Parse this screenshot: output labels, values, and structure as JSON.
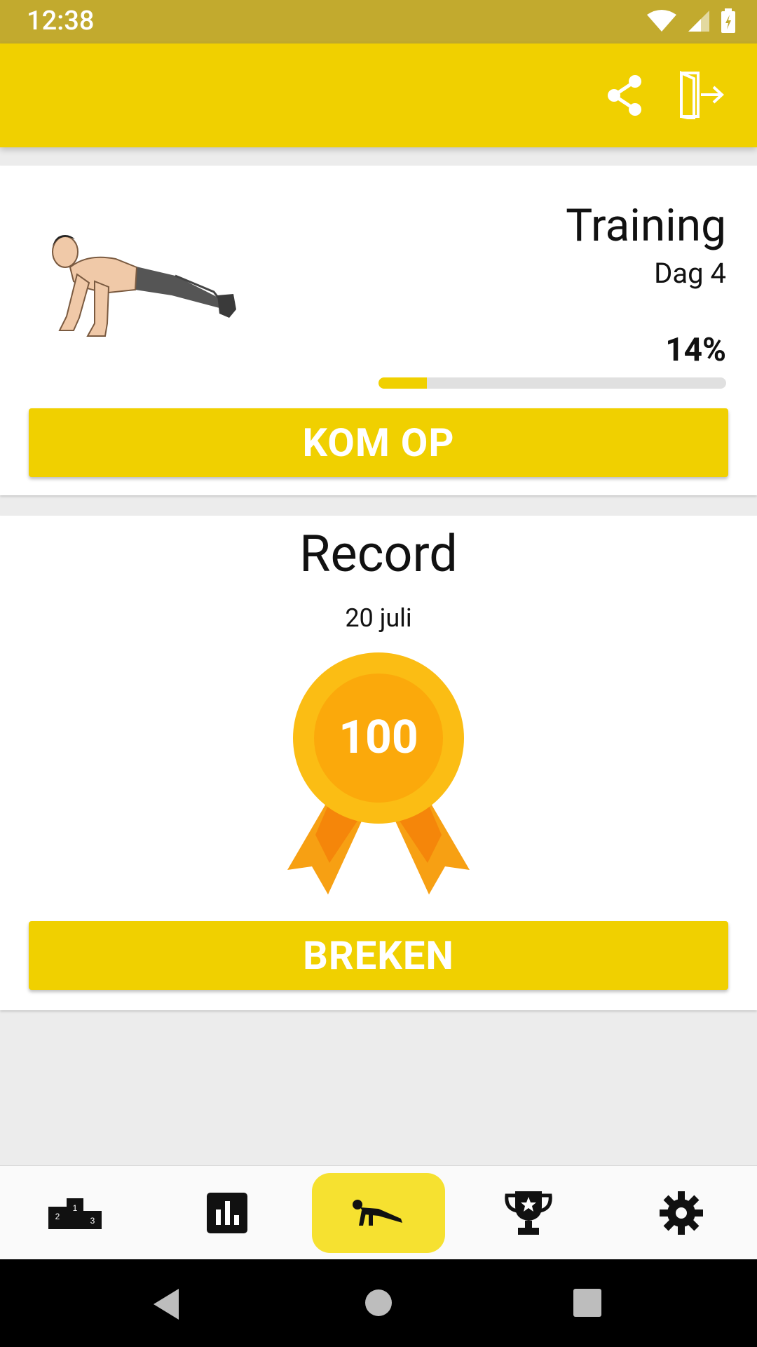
{
  "status_bar": {
    "time": "12:38",
    "icons": [
      "wifi-icon",
      "signal-icon",
      "battery-icon"
    ]
  },
  "app_bar": {
    "actions": [
      "share-icon",
      "exit-icon"
    ],
    "color": "#f0d000"
  },
  "training_card": {
    "title": "Training",
    "day": "Dag 4",
    "progress_label": "14%",
    "progress_fraction": 0.14,
    "button_label": "KOM OP",
    "image": "pushup-figure"
  },
  "record_card": {
    "title": "Record",
    "date": "20 juli",
    "medal_value": "100",
    "button_label": "BREKEN"
  },
  "bottom_nav": {
    "items": [
      "podium-icon",
      "chart-icon",
      "pushup-icon",
      "trophy-icon",
      "gear-icon"
    ],
    "active_index": 2,
    "active_color": "#f6e130"
  },
  "system_nav": [
    "back-icon",
    "home-icon",
    "recents-icon"
  ]
}
